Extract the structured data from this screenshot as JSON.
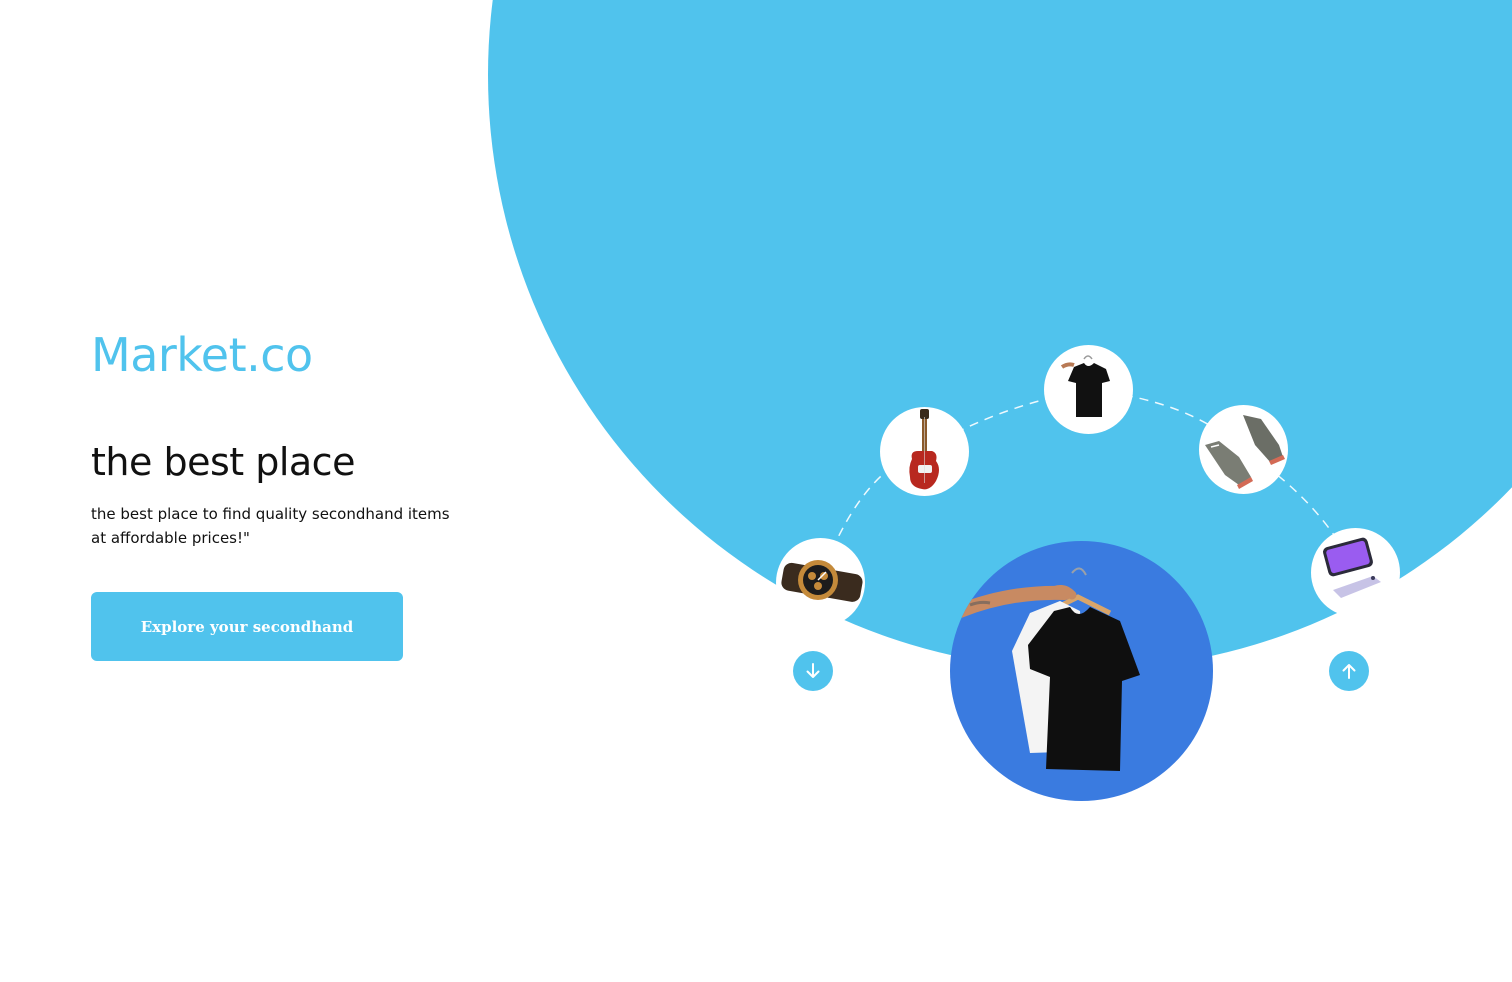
{
  "hero": {
    "brand": "Market.co",
    "headline": "the best place",
    "tagline": "the best place  to find quality secondhand items at affordable prices!\"",
    "cta_label": "Explore your secondhand"
  },
  "carousel": {
    "items": [
      {
        "name": "watch",
        "icon": "watch-icon"
      },
      {
        "name": "guitar",
        "icon": "guitar-icon"
      },
      {
        "name": "t-shirt",
        "icon": "tshirt-icon"
      },
      {
        "name": "sneakers",
        "icon": "sneakers-icon"
      },
      {
        "name": "phone",
        "icon": "phone-icon"
      }
    ],
    "featured": {
      "name": "t-shirt on hanger",
      "icon": "tshirt-hanger-icon"
    },
    "prev_icon": "arrow-down-icon",
    "next_icon": "arrow-up-icon"
  },
  "colors": {
    "accent": "#50c3ed",
    "featured_bg": "#3a7be0",
    "text": "#111111",
    "background": "#ffffff"
  }
}
